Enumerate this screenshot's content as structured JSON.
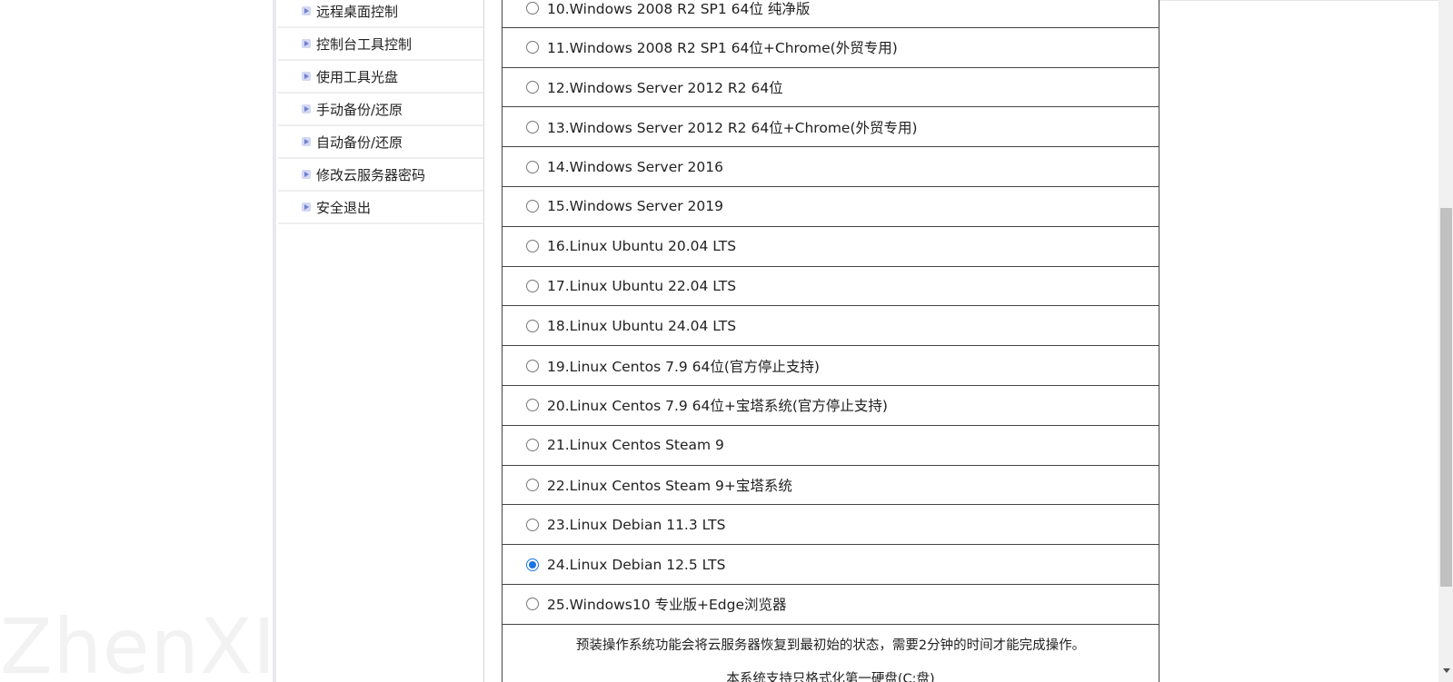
{
  "watermark": {
    "text": "ZhenXI"
  },
  "sidebar": {
    "items": [
      {
        "label": "远程桌面控制",
        "icon": "arrow-bullet-icon"
      },
      {
        "label": "控制台工具控制",
        "icon": "arrow-bullet-icon"
      },
      {
        "label": "使用工具光盘",
        "icon": "arrow-bullet-icon"
      },
      {
        "label": "手动备份/还原",
        "icon": "arrow-bullet-icon"
      },
      {
        "label": "自动备份/还原",
        "icon": "arrow-bullet-icon"
      },
      {
        "label": "修改云服务器密码",
        "icon": "arrow-bullet-icon"
      },
      {
        "label": "安全退出",
        "icon": "arrow-bullet-icon"
      }
    ]
  },
  "os_list": {
    "options": [
      {
        "label": "10.Windows 2008 R2 SP1 64位 纯净版",
        "checked": false
      },
      {
        "label": "11.Windows 2008 R2 SP1 64位+Chrome(外贸专用)",
        "checked": false
      },
      {
        "label": "12.Windows Server 2012 R2 64位",
        "checked": false
      },
      {
        "label": "13.Windows Server 2012 R2 64位+Chrome(外贸专用)",
        "checked": false
      },
      {
        "label": "14.Windows Server 2016",
        "checked": false
      },
      {
        "label": "15.Windows Server 2019",
        "checked": false
      },
      {
        "label": "16.Linux Ubuntu 20.04 LTS",
        "checked": false
      },
      {
        "label": "17.Linux Ubuntu 22.04 LTS",
        "checked": false
      },
      {
        "label": "18.Linux Ubuntu 24.04 LTS",
        "checked": false
      },
      {
        "label": "19.Linux Centos 7.9 64位(官方停止支持)",
        "checked": false
      },
      {
        "label": "20.Linux Centos 7.9 64位+宝塔系统(官方停止支持)",
        "checked": false
      },
      {
        "label": "21.Linux Centos Steam 9",
        "checked": false
      },
      {
        "label": "22.Linux Centos Steam 9+宝塔系统",
        "checked": false
      },
      {
        "label": "23.Linux Debian 11.3 LTS",
        "checked": false
      },
      {
        "label": "24.Linux Debian 12.5 LTS",
        "checked": true
      },
      {
        "label": "25.Windows10 专业版+Edge浏览器",
        "checked": false
      }
    ],
    "selected": "24.Linux Debian 12.5 LTS"
  },
  "notice": {
    "line1": "预装操作系统功能会将云服务器恢复到最初始的状态，需要2分钟的时间才能完成操作。",
    "line2": "本系统支持只格式化第一硬盘(C:盘)"
  },
  "scrollbar": {
    "position_fraction": 0.41
  },
  "colors": {
    "accent": "#1a73e8",
    "border": "#444444",
    "bullet": "#d3d8f2"
  }
}
